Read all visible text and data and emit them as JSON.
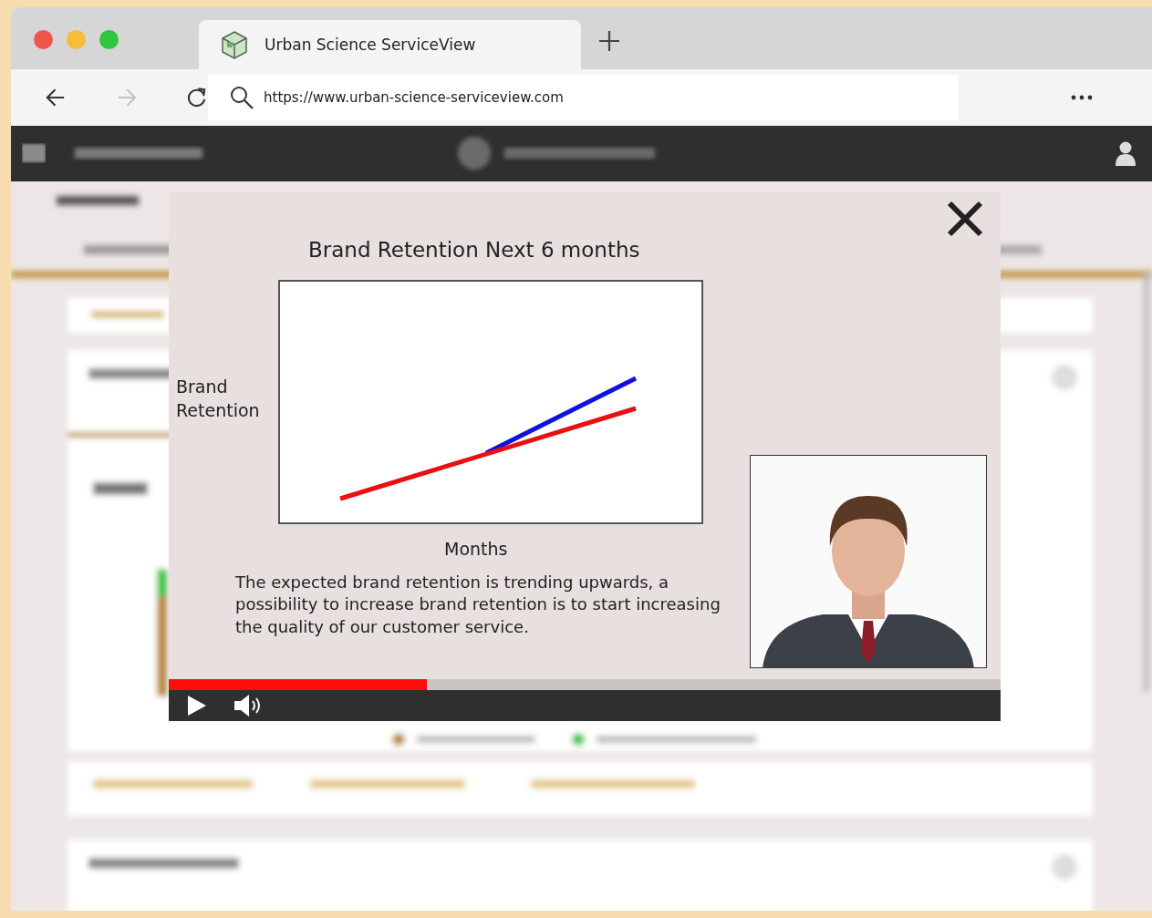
{
  "browser": {
    "tab": {
      "title": "Urban Science ServiceView"
    },
    "url": "https://www.urban-science-serviceview.com",
    "nav": [
      {
        "kind": "back",
        "disabled": false
      },
      {
        "kind": "forward",
        "disabled": true
      },
      {
        "kind": "reload",
        "disabled": false
      }
    ]
  },
  "video": {
    "title": "Brand Retention Next 6 months",
    "ylabel": "Brand Retention",
    "xlabel": "Months",
    "caption": "The expected brand retention is trending upwards, a possibility to increase brand retention is to start increasing the quality of our customer service.",
    "progress": {
      "level": 0.31
    },
    "playing": false
  }
}
